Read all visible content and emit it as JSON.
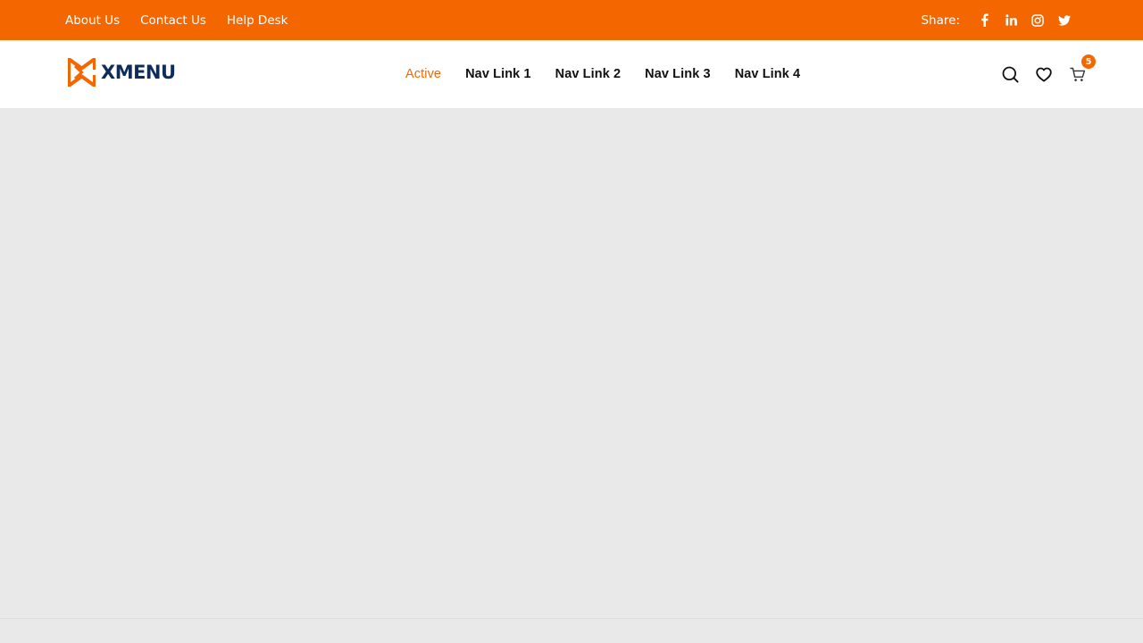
{
  "topbar": {
    "links": [
      {
        "label": "About Us"
      },
      {
        "label": "Contact Us"
      },
      {
        "label": "Help Desk"
      }
    ],
    "share_label": "Share:",
    "social_icons": [
      "facebook-icon",
      "linkedin-icon",
      "instagram-icon",
      "twitter-icon"
    ],
    "background": "#f46700"
  },
  "header": {
    "logo_text": "XMENU",
    "nav": [
      {
        "label": "Active",
        "active": true
      },
      {
        "label": "Nav Link 1"
      },
      {
        "label": "Nav Link 2"
      },
      {
        "label": "Nav Link 3"
      },
      {
        "label": "Nav Link 4"
      }
    ],
    "actions": [
      "search-icon",
      "heart-icon",
      "cart-icon"
    ],
    "cart_count": "5"
  },
  "colors": {
    "accent": "#f46700",
    "logo_text": "#0f2d5c",
    "content_bg": "#e9e9e9"
  }
}
